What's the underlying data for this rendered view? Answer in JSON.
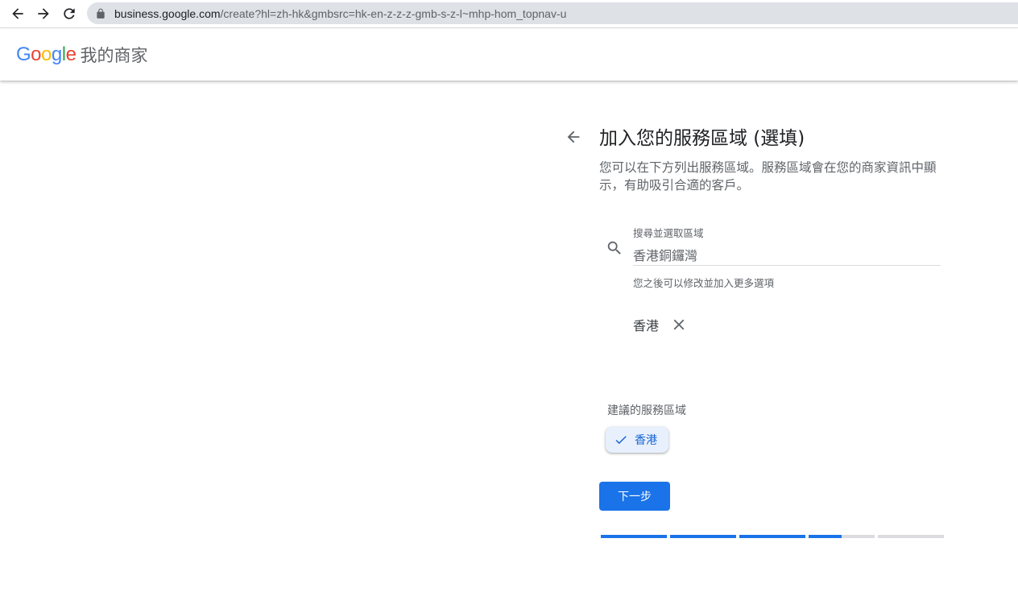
{
  "browser": {
    "url_host": "business.google.com",
    "url_path": "/create?hl=zh-hk&gmbsrc=hk-en-z-z-z-gmb-s-z-l~mhp-hom_topnav-u"
  },
  "header": {
    "logo_letters": [
      "G",
      "o",
      "o",
      "g",
      "l",
      "e"
    ],
    "product_name": "我的商家"
  },
  "main": {
    "title": "加入您的服務區域 (選填)",
    "description": "您可以在下方列出服務區域。服務區域會在您的商家資訊中顯示，有助吸引合適的客戶。",
    "search": {
      "label": "搜尋並選取區域",
      "value": "香港銅鑼灣",
      "helper": "您之後可以修改並加入更多選項"
    },
    "selected_areas": [
      "香港"
    ],
    "suggestions": {
      "heading": "建議的服務區域",
      "chips": [
        "香港"
      ]
    },
    "next_label": "下一步",
    "progress": [
      1,
      1,
      1,
      0.5,
      0
    ]
  },
  "colors": {
    "accent": "#1a73e8",
    "chip_bg": "#e8f0fe",
    "track": "#dadce0"
  }
}
